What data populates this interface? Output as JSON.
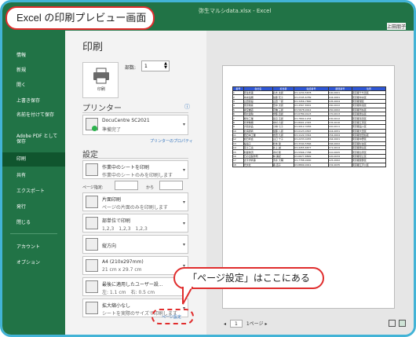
{
  "callouts": {
    "top": "Excel の印刷プレビュー画面",
    "bottom": "「ページ設定」はここにある"
  },
  "window": {
    "file_title": "弥生マルシdata.xlsx - Excel",
    "user": "上田朋子"
  },
  "sidebar": {
    "items": [
      {
        "label": "情報"
      },
      {
        "label": "新規"
      },
      {
        "label": "開く"
      },
      {
        "label": "上書き保存"
      },
      {
        "label": "名前を付けて保存"
      },
      {
        "label": "Adobe PDF として保存"
      },
      {
        "label": "印刷"
      },
      {
        "label": "共有"
      },
      {
        "label": "エクスポート"
      },
      {
        "label": "発行"
      },
      {
        "label": "閉じる"
      },
      {
        "label": "アカウント"
      },
      {
        "label": "オプション"
      }
    ]
  },
  "print": {
    "title": "印刷",
    "button": "印刷",
    "copies_label": "部数:",
    "copies_value": "1"
  },
  "printer": {
    "heading": "プリンター",
    "name": "DocuCentre SC2021",
    "status": "準備完了",
    "properties_link": "プリンターのプロパティ"
  },
  "settings": {
    "heading": "設定",
    "scope": {
      "title": "作業中のシートを印刷",
      "desc": "作業中のシートのみを印刷します"
    },
    "pages_label": "ページ指定:",
    "to_label": "から",
    "sides": {
      "title": "片面印刷",
      "desc": "ページの片面のみを印刷します"
    },
    "collate": {
      "title": "部単位で印刷",
      "desc": "1,2,3　1,2,3　1,2,3"
    },
    "orientation": {
      "title": "縦方向",
      "desc": ""
    },
    "paper": {
      "title": "A4 (210x297mm)",
      "desc": "21 cm x 29.7 cm"
    },
    "margins": {
      "title": "最後に適用したユーザー設...",
      "desc": "左: 1.1 cm　右: 0.5 cm"
    },
    "scaling": {
      "title": "拡大縮小なし",
      "desc": "シートを実際のサイズで印刷します"
    },
    "page_setup_link": "ページ設定"
  },
  "preview": {
    "page_current": "1",
    "page_total_label": "1ページ"
  },
  "sheet": {
    "headers": [
      "番号",
      "会社名",
      "担当者",
      "電話番号",
      "郵便番号",
      "住所"
    ],
    "rows": [
      [
        "1",
        "弥生商事",
        "鈴木 太郎",
        "03-1234-5678",
        "100-0001",
        "東京都千代田区"
      ],
      [
        "2",
        "中央電機",
        "佐藤 花子",
        "03-2345-6789",
        "104-0061",
        "東京都中央区"
      ],
      [
        "3",
        "山田建設",
        "山田 一郎",
        "03-3456-7890",
        "105-0004",
        "東京都港区"
      ],
      [
        "4",
        "東京物産",
        "田中 次郎",
        "03-4567-8901",
        "160-0022",
        "東京都新宿区"
      ],
      [
        "5",
        "青空書店",
        "高橋 三郎",
        "03-5678-9012",
        "150-0002",
        "東京都渋谷区"
      ],
      [
        "6",
        "南北運輸",
        "伊藤 四郎",
        "03-6789-0123",
        "170-0013",
        "東京都豊島区"
      ],
      [
        "7",
        "緑化工業",
        "渡辺 五郎",
        "03-7890-1234",
        "130-0012",
        "東京都墨田区"
      ],
      [
        "8",
        "光学精機",
        "中村 六郎",
        "03-8901-2345",
        "135-0016",
        "東京都江東区"
      ],
      [
        "9",
        "大和食品",
        "小林 七子",
        "03-9012-3456",
        "140-0011",
        "東京都品川区"
      ],
      [
        "10",
        "北海通商",
        "加藤 八郎",
        "03-0123-4567",
        "144-0051",
        "東京都大田区"
      ],
      [
        "11",
        "西日本工業",
        "吉田 九郎",
        "03-1122-3344",
        "154-0004",
        "東京都世田谷区"
      ],
      [
        "12",
        "旭日商会",
        "山口 十子",
        "03-2233-4455",
        "164-0001",
        "東京都中野区"
      ],
      [
        "13",
        "桜電子",
        "松本 健",
        "03-3344-5566",
        "166-0002",
        "東京都杉並区"
      ],
      [
        "14",
        "富士工房",
        "井上 誠",
        "03-4455-6677",
        "171-0014",
        "東京都豊島区"
      ],
      [
        "15",
        "新星物流",
        "木村 聡",
        "03-5566-7788",
        "110-0005",
        "東京都台東区"
      ],
      [
        "16",
        "日の出製作所",
        "林 美紀",
        "03-6677-8899",
        "120-0034",
        "東京都足立区"
      ],
      [
        "17",
        "太平洋商事",
        "清水 大輔",
        "03-7788-9900",
        "125-0062",
        "東京都葛飾区"
      ],
      [
        "18",
        "光文社",
        "森 直子",
        "03-8899-0011",
        "132-0035",
        "東京都江戸川区"
      ]
    ]
  },
  "colors": {
    "excel_green": "#217346",
    "callout_red": "#e02d2d",
    "frame_blue": "#42b3d6",
    "sheet_header": "#2f57d6"
  }
}
